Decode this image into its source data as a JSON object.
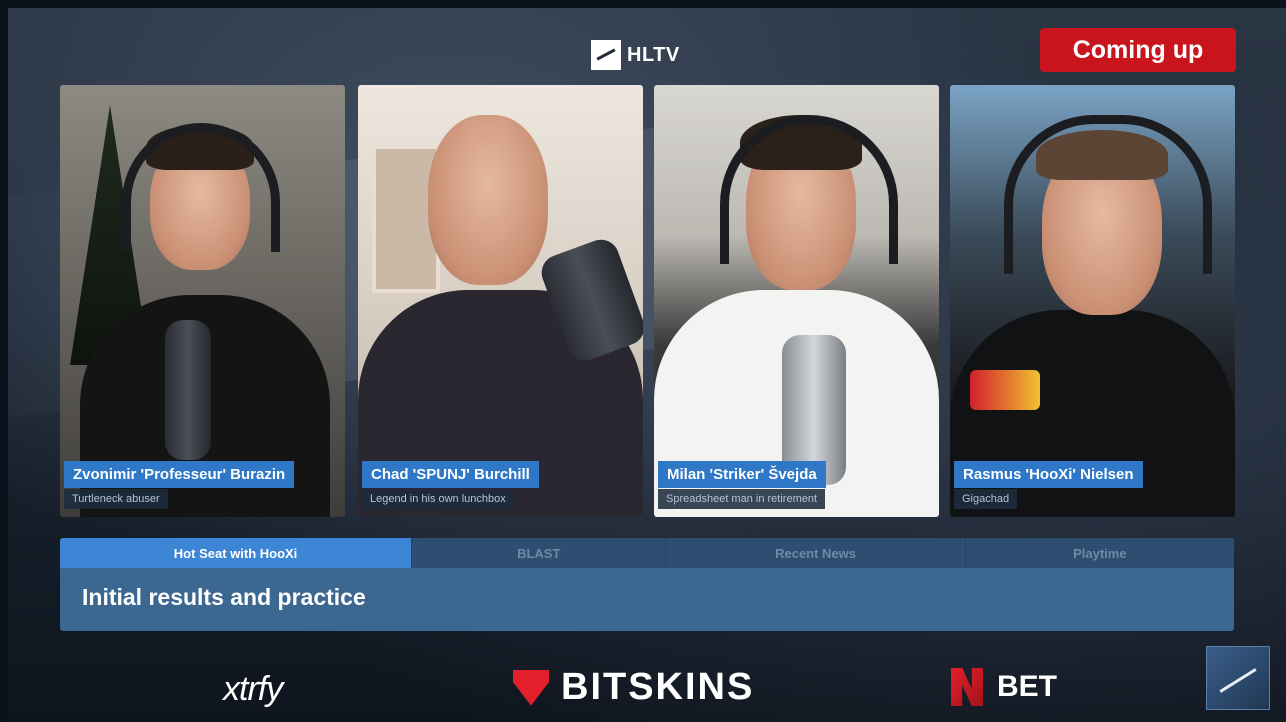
{
  "header": {
    "logo_text": "HLTV",
    "coming_up_label": "Coming up"
  },
  "panelists": [
    {
      "name": "Zvonimir 'Professeur' Burazin",
      "subtitle": "Turtleneck abuser"
    },
    {
      "name": "Chad 'SPUNJ' Burchill",
      "subtitle": "Legend in his own lunchbox"
    },
    {
      "name": "Milan 'Striker' Švejda",
      "subtitle": "Spreadsheet man in retirement"
    },
    {
      "name": "Rasmus 'HooXi' Nielsen",
      "subtitle": "Gigachad"
    }
  ],
  "ticker": {
    "tabs": [
      {
        "label": "Hot Seat with HooXi",
        "active": true
      },
      {
        "label": "BLAST",
        "active": false
      },
      {
        "label": "Recent News",
        "active": false
      },
      {
        "label": "Playtime",
        "active": false
      }
    ],
    "headline": "Initial results and practice"
  },
  "sponsors": {
    "xtrfy": "xtrfy",
    "bitskins": "BITSKINS",
    "nbet": "BET"
  },
  "colors": {
    "name_tag": "#2e78c7",
    "coming_up": "#c9141e",
    "ticker_bg": "#3b6791",
    "tab_active": "#3d86d6",
    "sponsor_red": "#e3202b"
  }
}
